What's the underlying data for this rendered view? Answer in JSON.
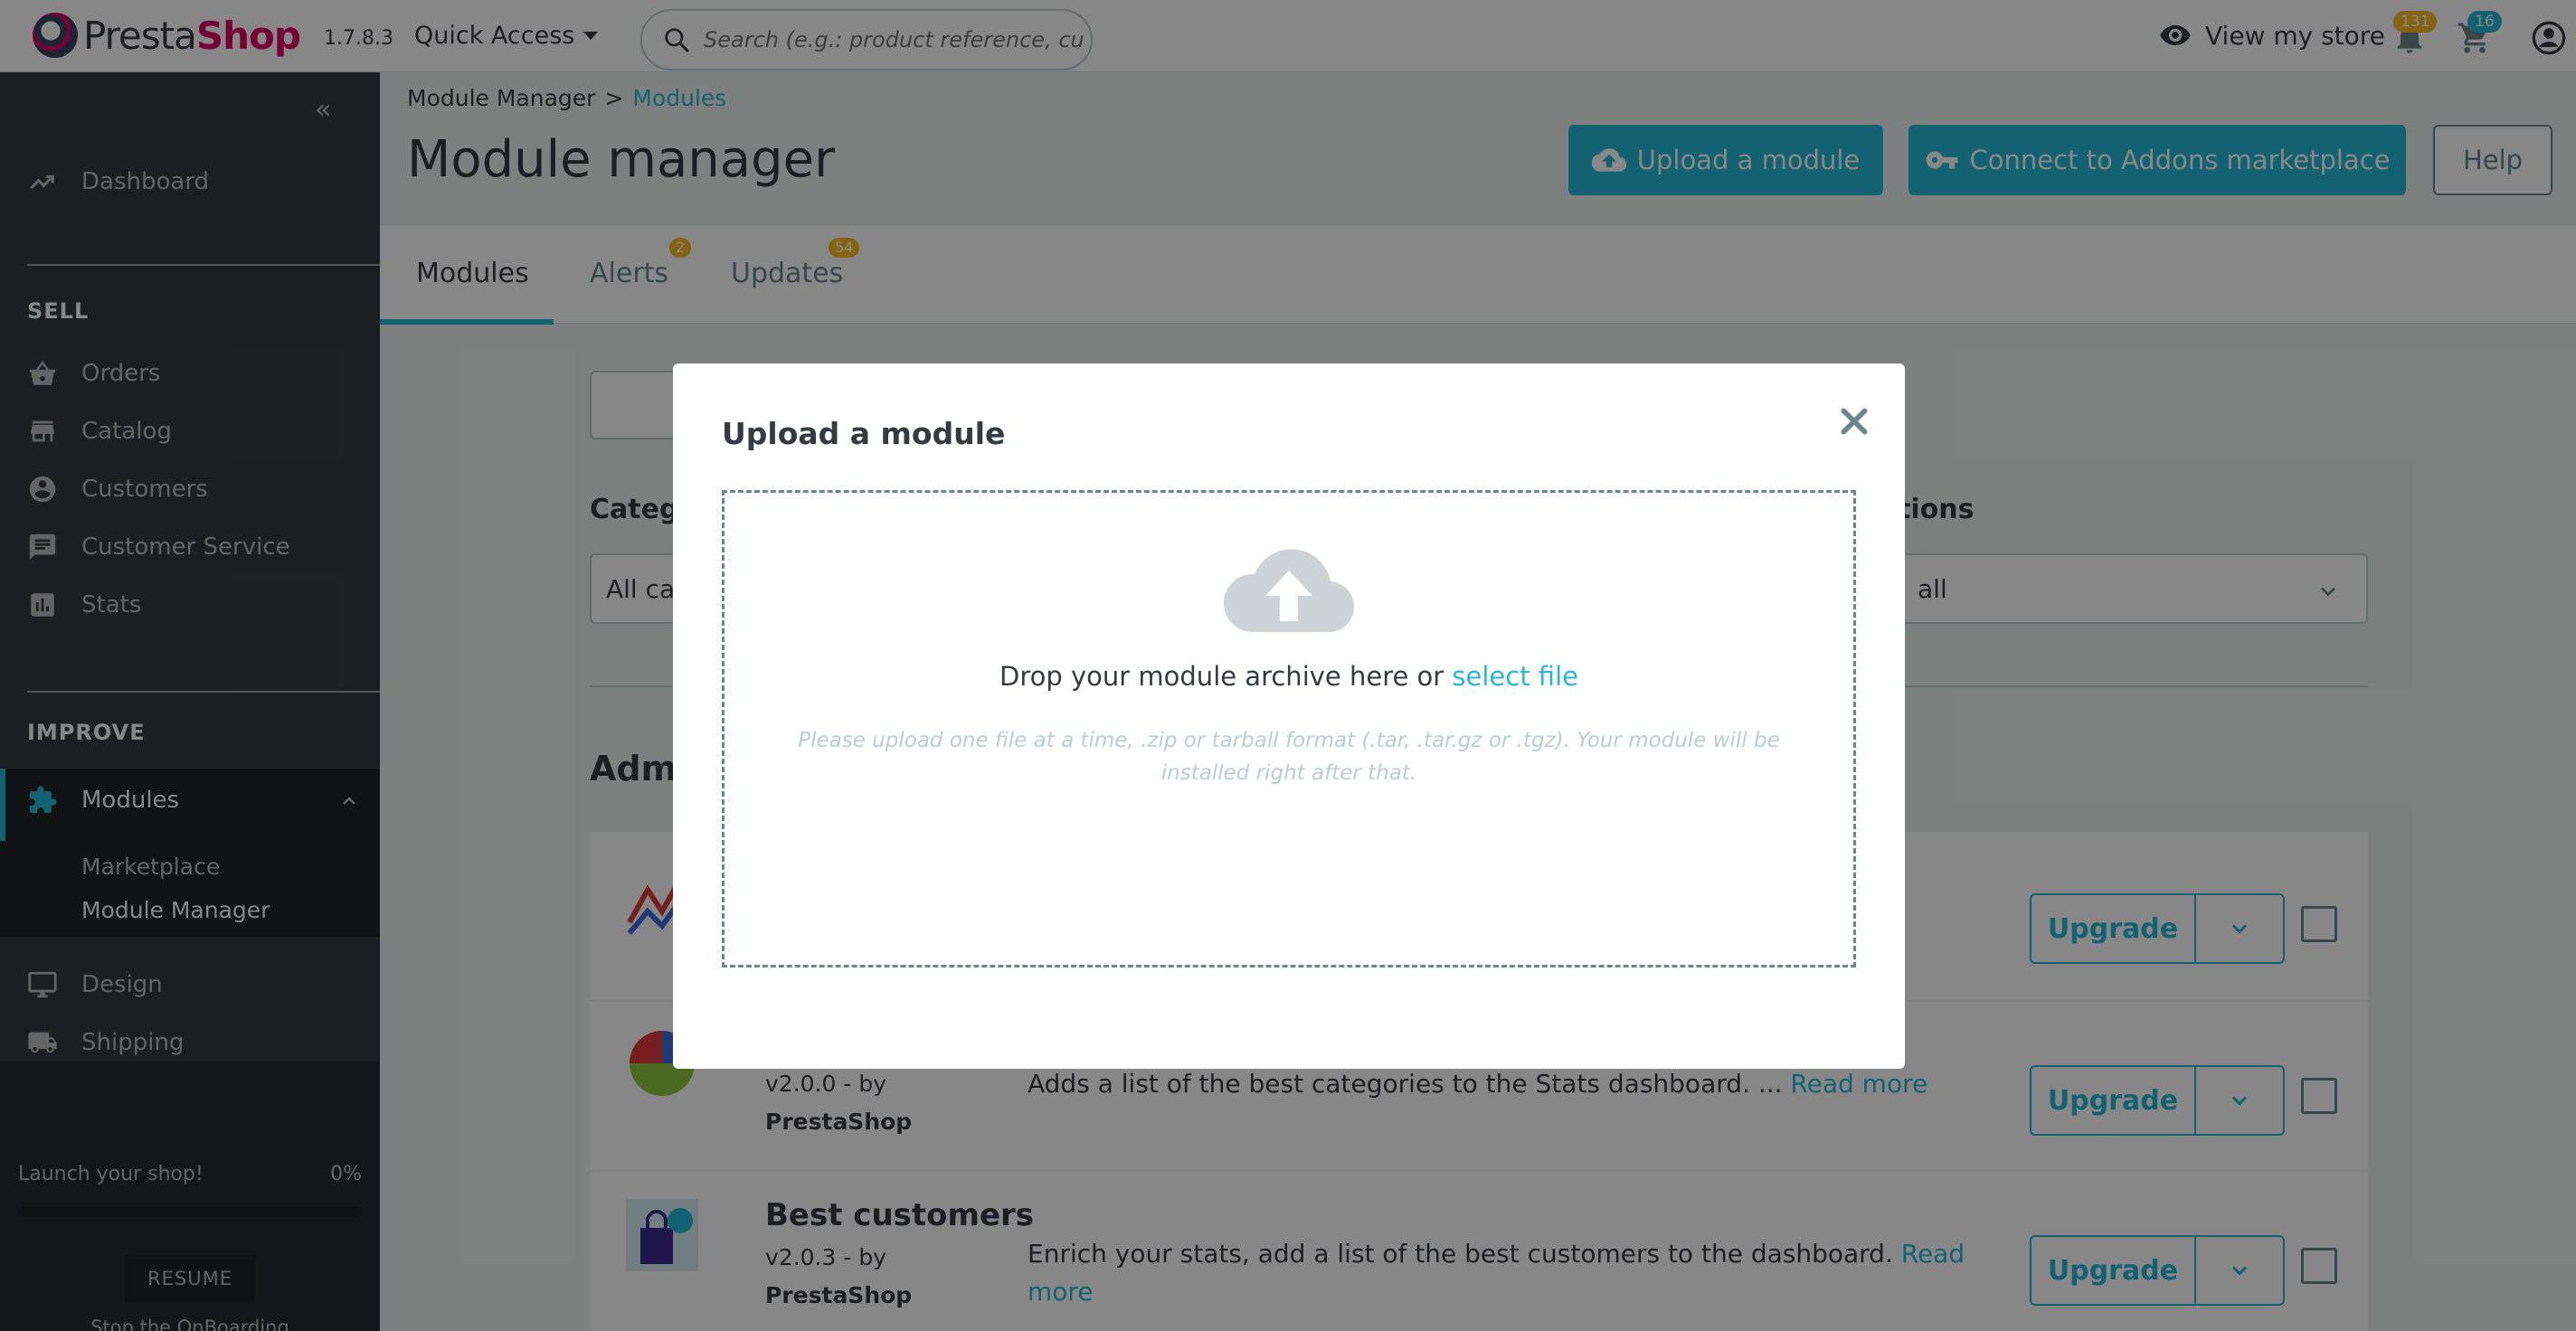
{
  "header": {
    "brand_prefix": "Presta",
    "brand_suffix": "Shop",
    "version": "1.7.8.3",
    "quick_access": "Quick Access",
    "search_placeholder": "Search (e.g.: product reference, custon",
    "view_store": "View my store",
    "notif_orders": "131",
    "notif_customers": "16"
  },
  "sidebar": {
    "dashboard": "Dashboard",
    "sell_section": "SELL",
    "orders": "Orders",
    "catalog": "Catalog",
    "customers": "Customers",
    "customer_service": "Customer Service",
    "stats": "Stats",
    "improve_section": "IMPROVE",
    "modules": "Modules",
    "marketplace": "Marketplace",
    "module_manager": "Module Manager",
    "design": "Design",
    "shipping": "Shipping",
    "launch": "Launch your shop!",
    "progress_label": "0%",
    "progress_value": 0,
    "resume": "RESUME",
    "stop": "Stop the OnBoarding"
  },
  "breadcrumb": {
    "parent": "Module Manager",
    "separator": ">",
    "current": "Modules"
  },
  "page": {
    "title": "Module manager",
    "upload_button": "Upload a module",
    "connect_button": "Connect to Addons marketplace",
    "help_button": "Help"
  },
  "tabs": [
    {
      "label": "Modules",
      "badge": ""
    },
    {
      "label": "Alerts",
      "badge": "2"
    },
    {
      "label": "Updates",
      "badge": "54"
    }
  ],
  "filters": {
    "category_label_visible": "Catego",
    "category_value_visible": "All cat",
    "status_label_visible": "tions",
    "status_value_visible": "all"
  },
  "section_title_visible": "Admi",
  "modules": [
    {
      "name": "",
      "version": "",
      "author": "",
      "description": "",
      "read_more": ""
    },
    {
      "name": "",
      "version": "v2.0.0 - by",
      "author": "PrestaShop",
      "description": "Adds a list of the best categories to the Stats dashboard. ... ",
      "read_more": "Read more"
    },
    {
      "name": "Best customers",
      "version": "v2.0.3 - by",
      "author": "PrestaShop",
      "description": "Enrich your stats, add a list of the best customers to the dashboard. ",
      "read_more": "Read more"
    }
  ],
  "upgrade_label": "Upgrade",
  "modal": {
    "title": "Upload a module",
    "drop_text": "Drop your module archive here or ",
    "select_file": "select file",
    "hint": "Please upload one file at a time, .zip or tarball format (.tar, .tar.gz or .tgz). Your module will be installed right after that."
  },
  "colors": {
    "accent": "#25b9d7",
    "brand": "#df0067",
    "sidebar_bg": "#363a41",
    "badge": "#fbbb22"
  }
}
